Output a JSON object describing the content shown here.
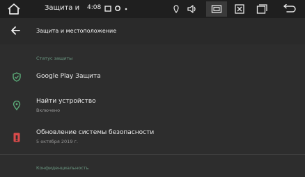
{
  "statusbar": {
    "title": "Защита и",
    "time": "4:08"
  },
  "toolbar": {
    "title": "Защита и местоположение"
  },
  "sections": {
    "status_header": "Статус защиты",
    "privacy_header": "Конфиденциальность"
  },
  "items": [
    {
      "title": "Google Play Защита",
      "subtitle": ""
    },
    {
      "title": "Найти устройство",
      "subtitle": "Включено"
    },
    {
      "title": "Обновление системы безопасности",
      "subtitle": "5 октября 2019 г."
    }
  ],
  "colors": {
    "accent_green": "#5cae7a",
    "warning_red": "#d94a4a"
  }
}
